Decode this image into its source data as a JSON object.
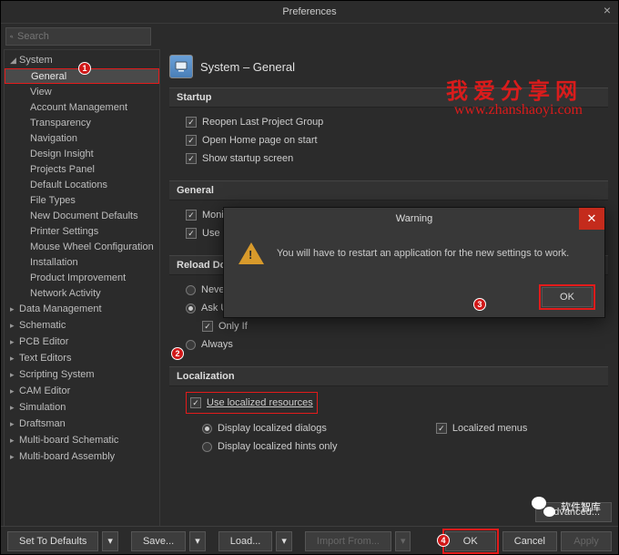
{
  "window": {
    "title": "Preferences"
  },
  "search": {
    "placeholder": "Search"
  },
  "tree": {
    "root": "System",
    "items": [
      "General",
      "View",
      "Account Management",
      "Transparency",
      "Navigation",
      "Design Insight",
      "Projects Panel",
      "Default Locations",
      "File Types",
      "New Document Defaults",
      "Printer Settings",
      "Mouse Wheel Configuration",
      "Installation",
      "Product Improvement",
      "Network Activity"
    ],
    "collapsed": [
      "Data Management",
      "Schematic",
      "PCB Editor",
      "Text Editors",
      "Scripting System",
      "CAM Editor",
      "Simulation",
      "Draftsman",
      "Multi-board Schematic",
      "Multi-board Assembly"
    ]
  },
  "header": {
    "title": "System – General"
  },
  "startup": {
    "title": "Startup",
    "reopen": "Reopen Last Project Group",
    "openhome": "Open Home page on start",
    "showstart": "Show startup screen"
  },
  "general": {
    "title": "General",
    "monitor": "Monitor clipboard content within this application only",
    "leftright": "Use Left/Right selection"
  },
  "reload": {
    "title": "Reload Docum",
    "never": "Never",
    "ask": "Ask User",
    "onlyif": "Only If",
    "always": "Always"
  },
  "localization": {
    "title": "Localization",
    "use": "Use localized resources",
    "dialogs": "Display localized dialogs",
    "hints": "Display localized hints only",
    "menus": "Localized menus"
  },
  "buttons": {
    "advanced": "Advanced...",
    "defaults": "Set To Defaults",
    "save": "Save...",
    "load": "Load...",
    "import": "Import From...",
    "ok": "OK",
    "cancel": "Cancel",
    "apply": "Apply"
  },
  "warning": {
    "title": "Warning",
    "message": "You will have to restart an application for the new settings to work.",
    "ok": "OK"
  },
  "watermark": {
    "line1": "我爱分享网",
    "line2": "www.zhanshaoyi.com",
    "wechat": "软件智库"
  },
  "ann": {
    "a1": "1",
    "a2": "2",
    "a3": "3",
    "a4": "4"
  }
}
